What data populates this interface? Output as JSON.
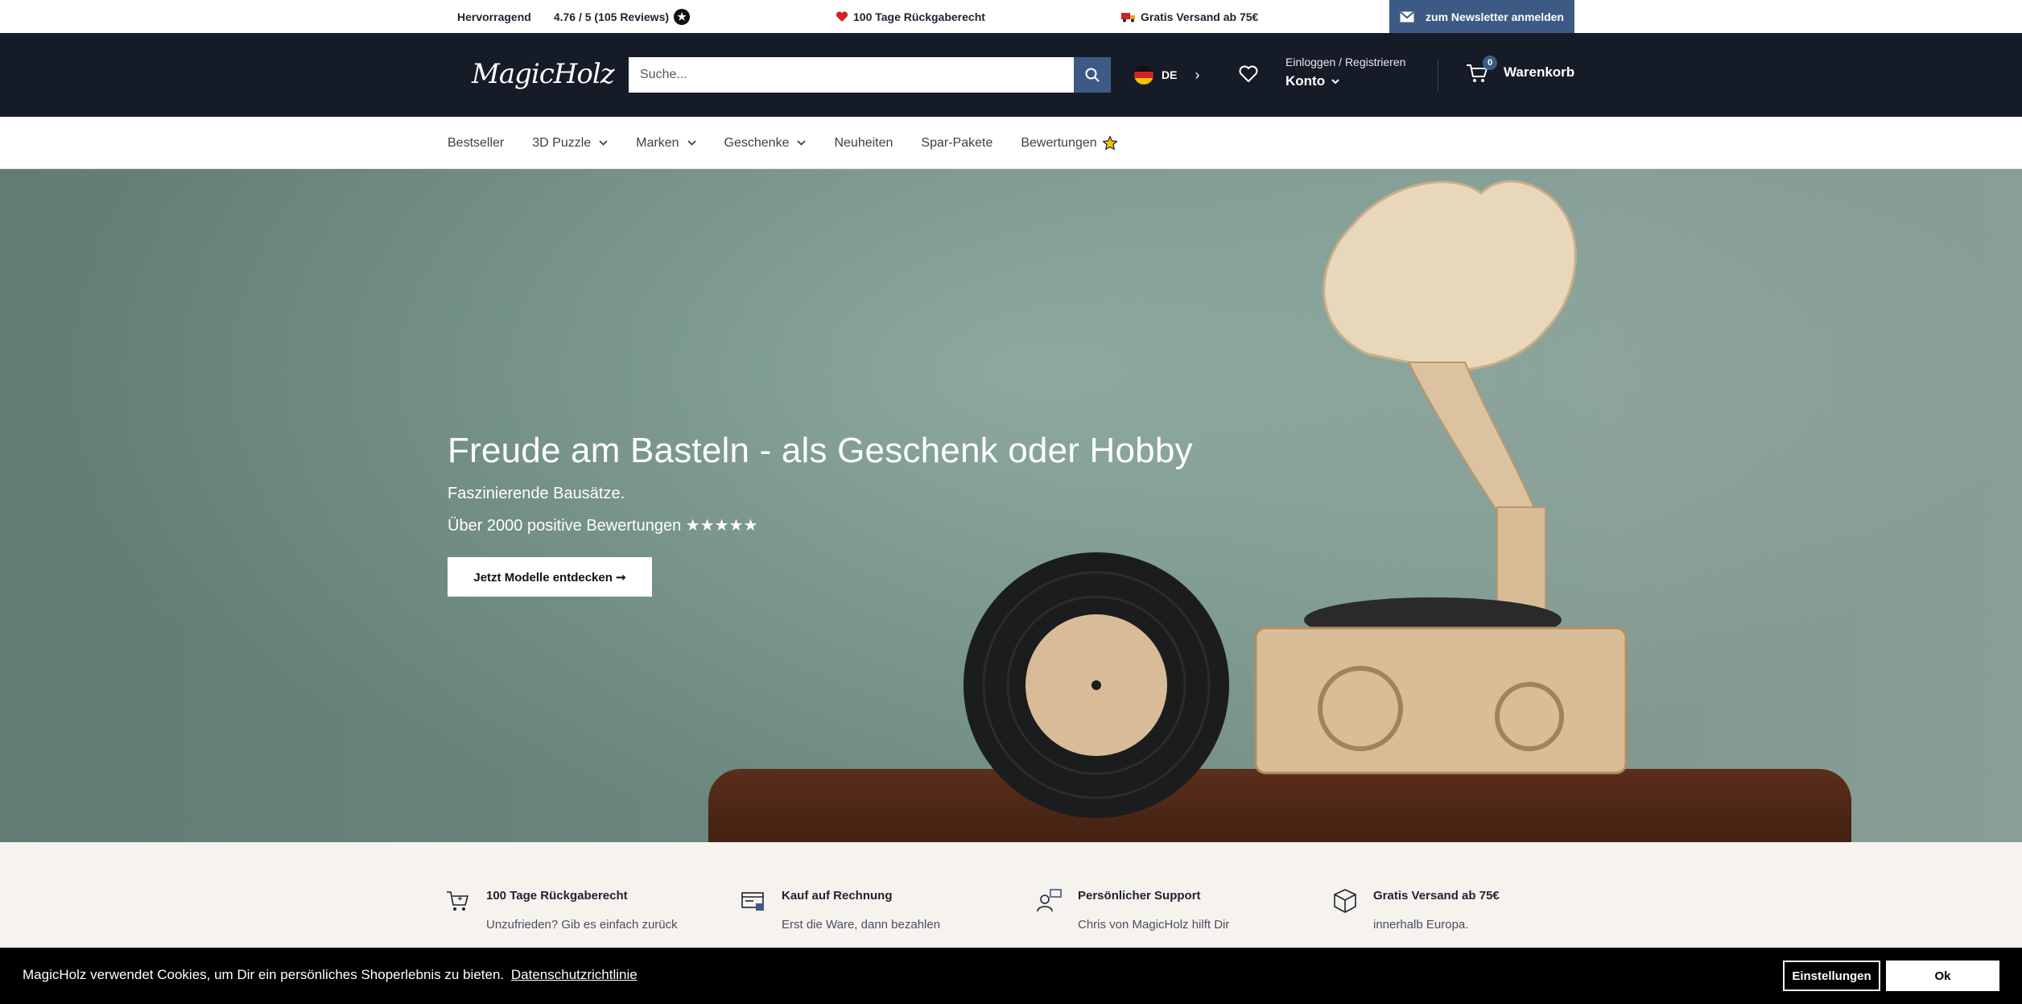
{
  "topbar": {
    "rating_label": "Hervorragend",
    "rating_score": "4.76 / 5 (105 Reviews)",
    "return_text": "100 Tage Rückgaberecht",
    "shipping_text": "Gratis Versand ab 75€",
    "newsletter_label": "zum Newsletter anmelden"
  },
  "header": {
    "logo_text": "MagicHolz",
    "search_placeholder": "Suche...",
    "language": "DE",
    "account_login": "Einloggen / Registrieren",
    "account_label": "Konto",
    "cart_count": "0",
    "cart_label": "Warenkorb"
  },
  "nav": {
    "items": [
      {
        "label": "Bestseller"
      },
      {
        "label": "3D Puzzle"
      },
      {
        "label": "Marken"
      },
      {
        "label": "Geschenke"
      },
      {
        "label": "Neuheiten"
      },
      {
        "label": "Spar-Pakete"
      },
      {
        "label": "Bewertungen"
      }
    ]
  },
  "hero": {
    "title": "Freude am Basteln - als Geschenk oder Hobby",
    "subtitle1": "Faszinierende Bausätze.",
    "subtitle2": "Über 2000 positive Bewertungen ★★★★★",
    "cta_label": "Jetzt Modelle entdecken ➞"
  },
  "features": [
    {
      "title": "100 Tage Rückgaberecht",
      "desc": "Unzufrieden? Gib es einfach zurück",
      "icon": "cart-return-icon"
    },
    {
      "title": "Kauf auf Rechnung",
      "desc": "Erst die Ware, dann bezahlen",
      "icon": "invoice-icon"
    },
    {
      "title": "Persönlicher Support",
      "desc": "Chris von MagicHolz hilft Dir",
      "icon": "support-chat-icon"
    },
    {
      "title": "Gratis Versand ab 75€",
      "desc": "innerhalb Europa.",
      "icon": "package-icon"
    }
  ],
  "cookie": {
    "text": "MagicHolz verwendet Cookies, um Dir ein persönliches Shoperlebnis zu bieten.",
    "link": "Datenschutzrichtlinie",
    "settings_label": "Einstellungen",
    "ok_label": "Ok"
  },
  "colors": {
    "header_bg": "#161c27",
    "accent": "#3d5a86",
    "hero_bg": "#77978d",
    "features_bg": "#f6f2ee"
  }
}
